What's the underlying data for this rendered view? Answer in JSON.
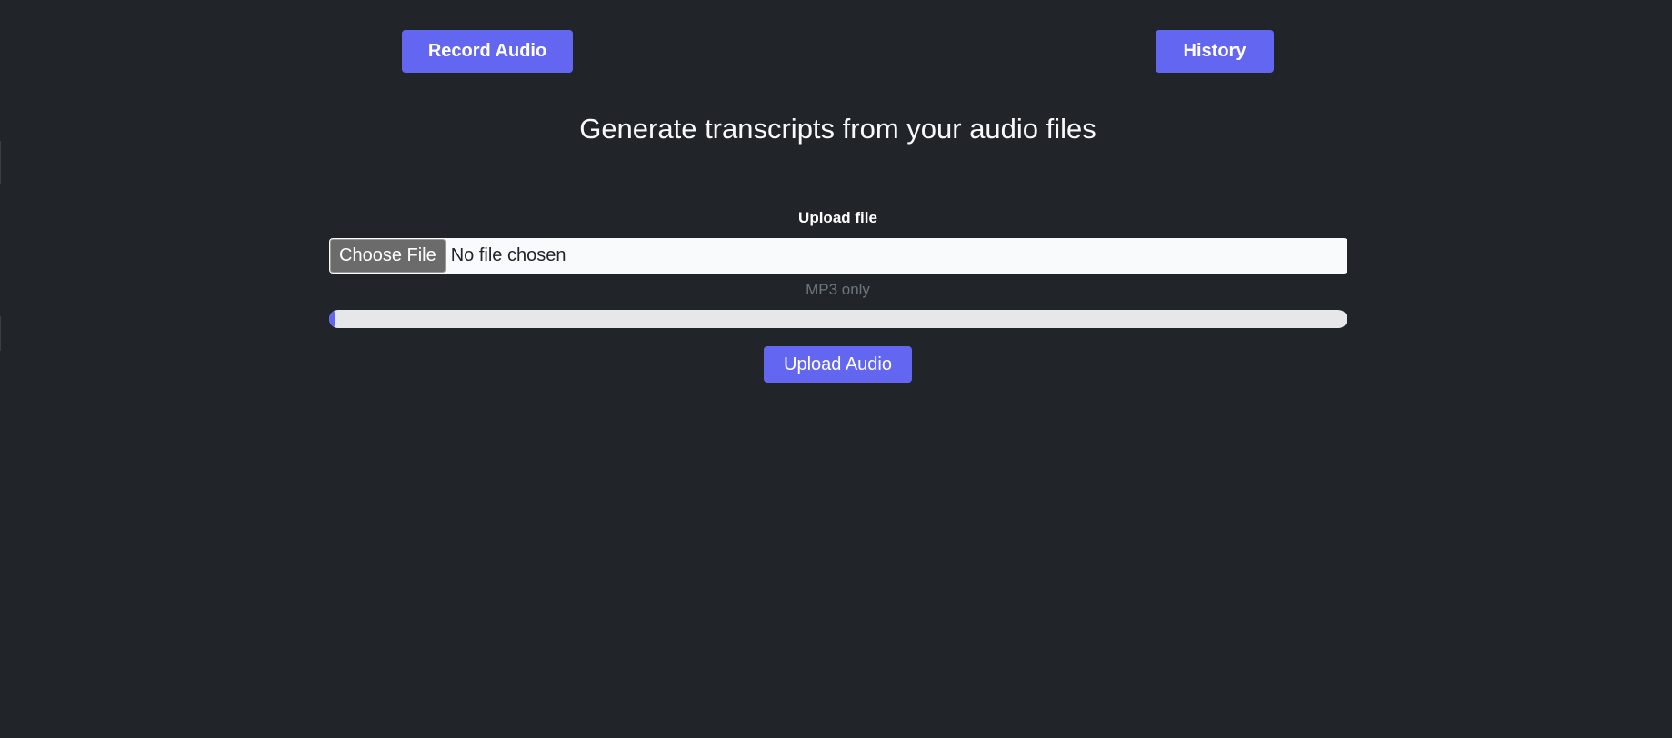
{
  "header": {
    "record_label": "Record Audio",
    "history_label": "History"
  },
  "main": {
    "title": "Generate transcripts from your audio files",
    "upload_label": "Upload file",
    "file_input": {
      "button_label": "Choose File",
      "status_text": "No file chosen"
    },
    "hint": "MP3 only",
    "progress_percent": 0,
    "upload_button_label": "Upload Audio"
  },
  "colors": {
    "background": "#212529",
    "accent": "#6366f1",
    "progress_track": "#e5e7eb"
  }
}
